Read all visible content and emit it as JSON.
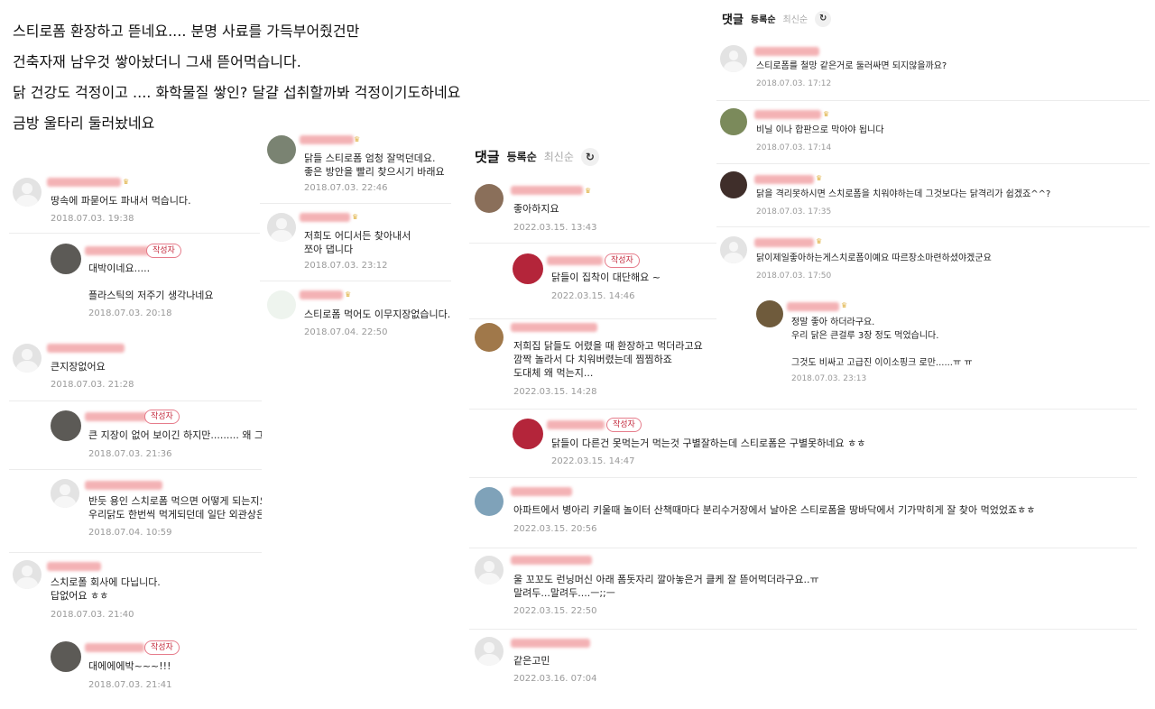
{
  "post": {
    "lines": [
      "스티로폼 환장하고 뜯네요.... 분명 사료를  가득부어줬건만",
      "건축자재 남우것 쌓아놨더니 그새 뜯어먹습니다.",
      "닭 건강도 걱정이고 .... 화학물질 쌓인? 달걀 섭취할까봐 걱정이기도하네요",
      "금방 울타리 둘러놨네요"
    ]
  },
  "author_badge": "작성자",
  "panel_left": {
    "comments": [
      {
        "body": "땅속에 파묻어도 파내서 먹습니다.",
        "date": "2018.07.03. 19:38"
      },
      {
        "body": "대박이네요.....\n\n플라스틱의 저주기 생각나네요",
        "date": "2018.07.03. 20:18"
      },
      {
        "body": "큰지장없어요",
        "date": "2018.07.03. 21:28"
      },
      {
        "body": "큰 지장이 없어 보이긴 하지만......... 왜 그런줄 혹시 아시나요??????",
        "date": "2018.07.03. 21:36"
      },
      {
        "body": "반듯 용인 스치로폼 먹으면 어떻게 되는지요?\n우리닭도 한번씩 먹게되던데 일단 외관상은 특별해 보이지 않던데요",
        "date": "2018.07.04. 10:59"
      },
      {
        "body": "스치로폴 회사에 다닙니다.\n답없어요 ㅎㅎ",
        "date": "2018.07.03. 21:40"
      },
      {
        "body": "대에에에박~~~!!!",
        "date": "2018.07.03. 21:41"
      }
    ]
  },
  "panel_mid": {
    "comments": [
      {
        "body": "닭들 스티로폼 엄청 잘먹던데요.\n좋은 방안을 빨리 찾으시기 바래요",
        "date": "2018.07.03. 22:46"
      },
      {
        "body": "저희도 어디서든 찾아내서\n쪼아 댑니다",
        "date": "2018.07.03. 23:12"
      },
      {
        "body": "스티로폼 먹어도 이무지장없습니다.",
        "date": "2018.07.04. 22:50"
      }
    ]
  },
  "panel_center": {
    "header": {
      "title": "댓글",
      "sort_active": "등록순",
      "sort_inactive": "최신순",
      "refresh_icon": "↻"
    },
    "comments": [
      {
        "body": "좋아하지요",
        "date": "2022.03.15. 13:43"
      },
      {
        "body": "닭들이 집착이 대단해요 ~",
        "date": "2022.03.15. 14:46"
      },
      {
        "body": "저희집 닭들도 어렸을 때 환장하고 먹더라고요\n깜짝 놀라서 다 치워버렸는데 찜찜하죠\n도대체 왜 먹는지...",
        "date": "2022.03.15. 14:28"
      },
      {
        "body": "닭들이 다른건 못먹는거 먹는것 구별잘하는데 스티로폼은 구별못하네요 ㅎㅎ",
        "date": "2022.03.15. 14:47"
      },
      {
        "body": "아파트에서 병아리 키울때 놀이터 산책때마다 분리수거장에서 날아온 스티로폼을 땅바닥에서 기가막히게 잘 찾아 먹었었죠ㅎㅎ",
        "date": "2022.03.15. 20:56"
      },
      {
        "body": "울 꼬꼬도 런닝머신 아래 폼돗자리 깔아놓은거 클케 잘 뜯어먹더라구요..ㅠ\n말려두...말려두....ㅡ;;ㅡ",
        "date": "2022.03.15. 22:50"
      },
      {
        "body": "같은고민",
        "date": "2022.03.16. 07:04"
      }
    ]
  },
  "panel_right": {
    "header": {
      "title": "댓글",
      "sort_active": "등록순",
      "sort_inactive": "최신순",
      "refresh_icon": "↻"
    },
    "comments": [
      {
        "body": "스티로폼를 철망 같은거로 둘러싸면 되지않을까요?",
        "date": "2018.07.03. 17:12"
      },
      {
        "body": "비닐 이나 합판으로 막아야 됩니다",
        "date": "2018.07.03. 17:14"
      },
      {
        "body": "닭을 격리못하시면 스치로폼을 치워야하는데 그것보다는 닭격리가 쉽겠죠^^?",
        "date": "2018.07.03. 17:35"
      },
      {
        "body": "닭이제일좋아하는게스치로폼이예요 따르장소마련하셨야겠군요",
        "date": "2018.07.03. 17:50"
      },
      {
        "body": "정말 좋아 하더라구요.\n우리 닭은 큰걸루 3장 정도 먹었습니다.\n\n그것도 비싸고 고급진 이이소핑크 로만......ㅠ ㅠ",
        "date": "2018.07.03. 23:13"
      }
    ]
  },
  "colors": {
    "badge": "#c42b3e",
    "date": "#999999",
    "nickname_blur": "#f2a5a8"
  }
}
